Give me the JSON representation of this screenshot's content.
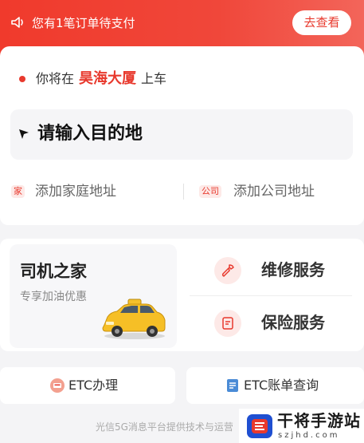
{
  "banner": {
    "text": "您有1笔订单待支付",
    "button_label": "去查看",
    "icon": "megaphone-icon"
  },
  "pickup": {
    "prefix": "你将在",
    "location": "昊海大厦",
    "suffix": "上车"
  },
  "destination": {
    "placeholder": "请输入目的地",
    "icon": "arrow-icon"
  },
  "shortcuts": {
    "home_tag": "家",
    "home_label": "添加家庭地址",
    "work_tag": "公司",
    "work_label": "添加公司地址"
  },
  "driver_home": {
    "title": "司机之家",
    "subtitle": "专享加油优惠",
    "image": "taxi-car-icon"
  },
  "services": [
    {
      "label": "维修服务",
      "icon": "wrench-icon"
    },
    {
      "label": "保险服务",
      "icon": "insurance-icon"
    }
  ],
  "etc": [
    {
      "label": "ETC办理",
      "icon": "etc-card-icon"
    },
    {
      "label": "ETC账单查询",
      "icon": "bill-icon"
    }
  ],
  "footer": {
    "text": "光信5G消息平台提供技术与运营"
  },
  "watermark": {
    "title": "干将手游站",
    "url": "szjhd.com"
  },
  "colors": {
    "brand_red": "#e8392d",
    "tag_bg": "#fde9e7",
    "page_bg": "#f4f4f6"
  }
}
